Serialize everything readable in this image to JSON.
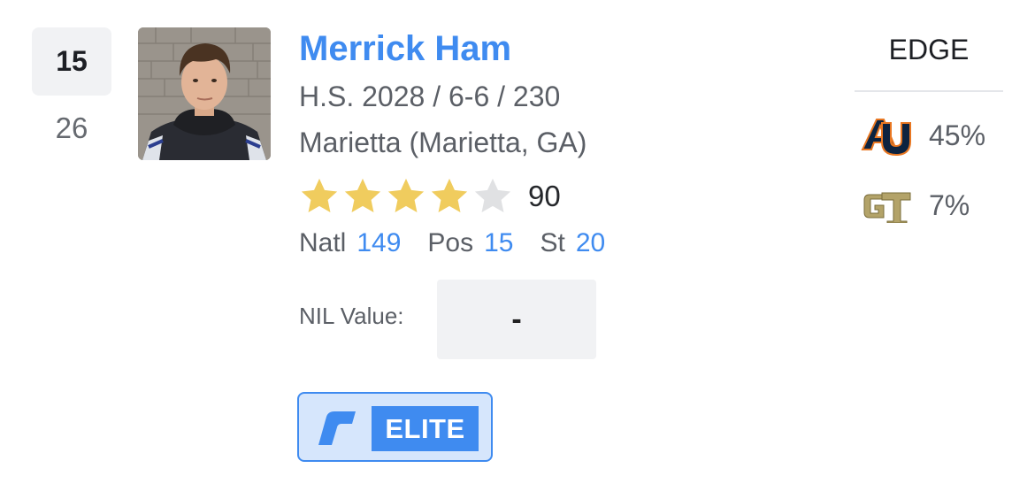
{
  "rank": {
    "primary": "15",
    "secondary": "26"
  },
  "player": {
    "name": "Merrick Ham",
    "meta": "H.S. 2028 / 6-6 / 230",
    "school": "Marietta (Marietta, GA)",
    "stars_filled": 4,
    "stars_total": 5,
    "rating": "90",
    "rankings": {
      "natl_label": "Natl",
      "natl_value": "149",
      "pos_label": "Pos",
      "pos_value": "15",
      "st_label": "St",
      "st_value": "20"
    },
    "nil": {
      "label": "NIL Value:",
      "value": "-"
    },
    "badge": {
      "label": "ELITE"
    }
  },
  "position": "EDGE",
  "predictions": [
    {
      "school_icon": "auburn-logo",
      "pct": "45%"
    },
    {
      "school_icon": "georgia-tech-logo",
      "pct": "7%"
    }
  ],
  "colors": {
    "accent": "#3f8bf0",
    "star_filled": "#f0cc5e",
    "star_empty": "#e0e1e3",
    "auburn_navy": "#0c2340",
    "auburn_orange": "#e87722",
    "gt_gold": "#b3a369"
  }
}
